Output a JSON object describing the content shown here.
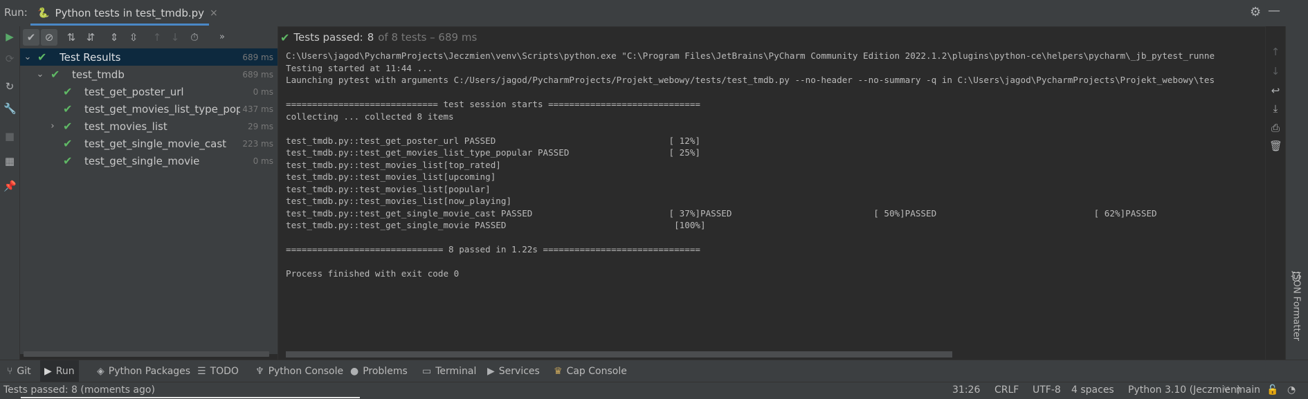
{
  "header": {
    "run_label": "Run:",
    "tab_title": "Python tests in test_tmdb.py",
    "tab_close": "×",
    "settings_icon": "gear-icon",
    "minimize_icon": "minimize-icon"
  },
  "status": {
    "passed_label": "Tests passed:",
    "passed_count": "8",
    "of_total": "of 8 tests – 689 ms"
  },
  "tree": {
    "root": {
      "name": "Test Results",
      "time": "689 ms"
    },
    "module": {
      "name": "test_tmdb",
      "time": "689 ms"
    },
    "items": [
      {
        "name": "test_get_poster_url",
        "time": "0 ms"
      },
      {
        "name": "test_get_movies_list_type_popula",
        "time": "437 ms"
      },
      {
        "name": "test_movies_list",
        "time": "29 ms"
      },
      {
        "name": "test_get_single_movie_cast",
        "time": "223 ms"
      },
      {
        "name": "test_get_single_movie",
        "time": "0 ms"
      }
    ]
  },
  "console": {
    "lines": [
      "C:\\Users\\jagod\\PycharmProjects\\Jeczmien\\venv\\Scripts\\python.exe \"C:\\Program Files\\JetBrains\\PyCharm Community Edition 2022.1.2\\plugins\\python-ce\\helpers\\pycharm\\_jb_pytest_runne",
      "Testing started at 11:44 ...",
      "Launching pytest with arguments C:/Users/jagod/PycharmProjects/Projekt_webowy/tests/test_tmdb.py --no-header --no-summary -q in C:\\Users\\jagod\\PycharmProjects\\Projekt_webowy\\tes",
      "",
      "============================= test session starts =============================",
      "collecting ... collected 8 items",
      "",
      "test_tmdb.py::test_get_poster_url PASSED                                 [ 12%]",
      "test_tmdb.py::test_get_movies_list_type_popular PASSED                   [ 25%]",
      "test_tmdb.py::test_movies_list[top_rated]",
      "test_tmdb.py::test_movies_list[upcoming]",
      "test_tmdb.py::test_movies_list[popular]",
      "test_tmdb.py::test_movies_list[now_playing]",
      "test_tmdb.py::test_get_single_movie_cast PASSED                          [ 37%]PASSED                           [ 50%]PASSED                              [ 62%]PASSED",
      "test_tmdb.py::test_get_single_movie PASSED                                [100%]",
      "",
      "============================== 8 passed in 1.22s ==============================",
      "",
      "Process finished with exit code 0"
    ]
  },
  "json_formatter": {
    "icon": "{}",
    "label": "JSON Formatter"
  },
  "bottom_tabs": [
    {
      "label": "Git",
      "icon": "git-branch-icon"
    },
    {
      "label": "Run",
      "icon": "play-icon"
    },
    {
      "label": "Python Packages",
      "icon": "layers-icon"
    },
    {
      "label": "TODO",
      "icon": "list-icon"
    },
    {
      "label": "Python Console",
      "icon": "python-icon"
    },
    {
      "label": "Problems",
      "icon": "warning-icon"
    },
    {
      "label": "Terminal",
      "icon": "terminal-icon"
    },
    {
      "label": "Services",
      "icon": "services-play-icon"
    },
    {
      "label": "Cap Console",
      "icon": "cap-icon"
    }
  ],
  "statusbar": {
    "message": "Tests passed: 8 (moments ago)",
    "position": "31:26",
    "line_sep": "CRLF",
    "encoding": "UTF-8",
    "indent": "4 spaces",
    "interpreter": "Python 3.10 (Jeczmien)",
    "branch": "main"
  },
  "colors": {
    "pass_green": "#5fb865",
    "selection": "#0d293e",
    "panel": "#3c3f41",
    "editor": "#2b2b2b"
  }
}
